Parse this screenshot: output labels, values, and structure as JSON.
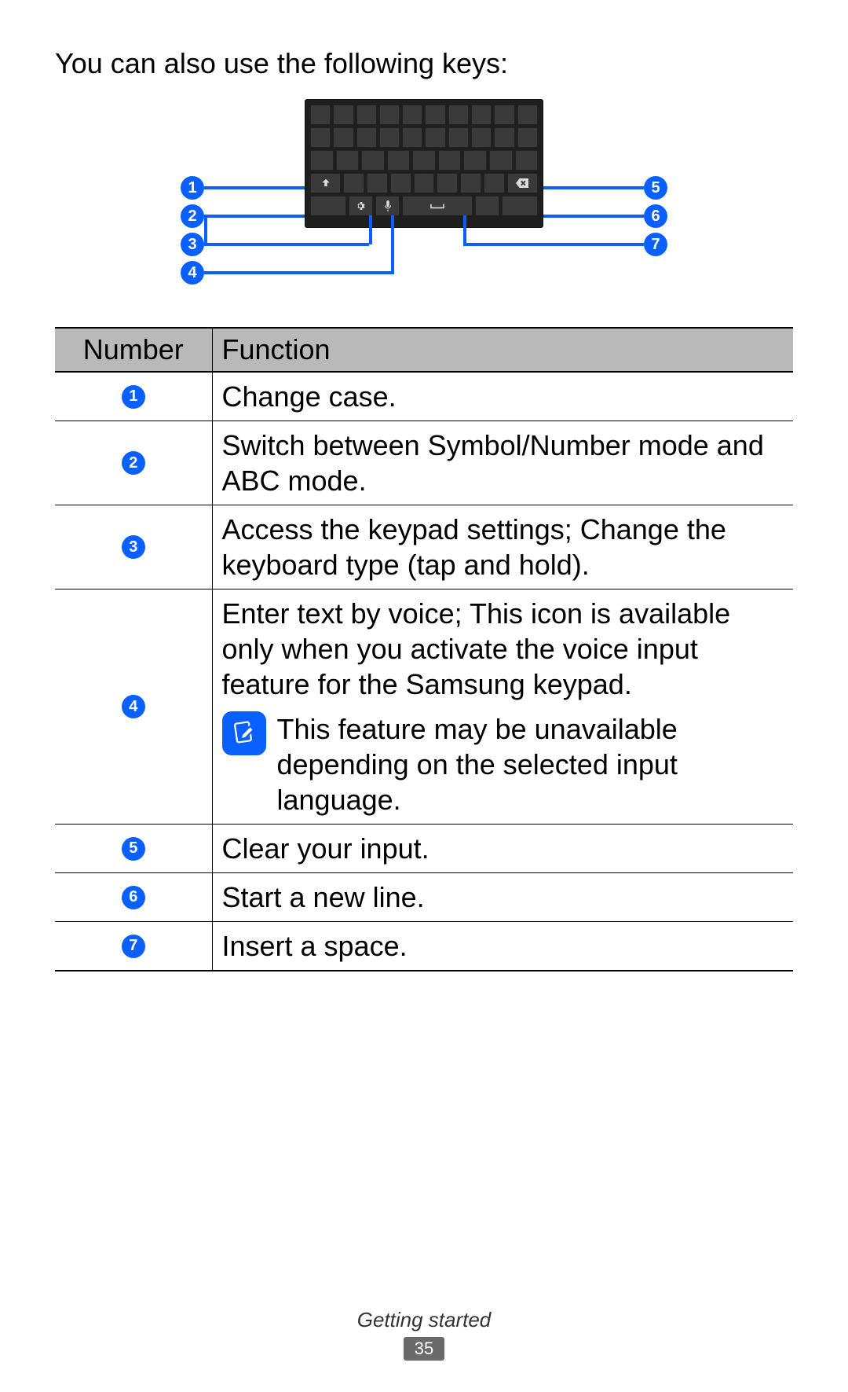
{
  "intro": "You can also use the following keys:",
  "callouts": {
    "c1": "1",
    "c2": "2",
    "c3": "3",
    "c4": "4",
    "c5": "5",
    "c6": "6",
    "c7": "7"
  },
  "table": {
    "headers": {
      "number": "Number",
      "function": "Function"
    },
    "rows": {
      "r1": {
        "num": "1",
        "fn": "Change case."
      },
      "r2": {
        "num": "2",
        "fn": "Switch between Symbol/Number mode and ABC mode."
      },
      "r3": {
        "num": "3",
        "fn": "Access the keypad settings; Change the keyboard type (tap and hold)."
      },
      "r4": {
        "num": "4",
        "fn_main": "Enter text by voice; This icon is available only when you activate the voice input feature for the Samsung keypad.",
        "fn_note": "This feature may be unavailable depending on the selected input language."
      },
      "r5": {
        "num": "5",
        "fn": "Clear your input."
      },
      "r6": {
        "num": "6",
        "fn": "Start a new line."
      },
      "r7": {
        "num": "7",
        "fn": "Insert a space."
      }
    }
  },
  "footer": {
    "section": "Getting started",
    "page": "35"
  }
}
